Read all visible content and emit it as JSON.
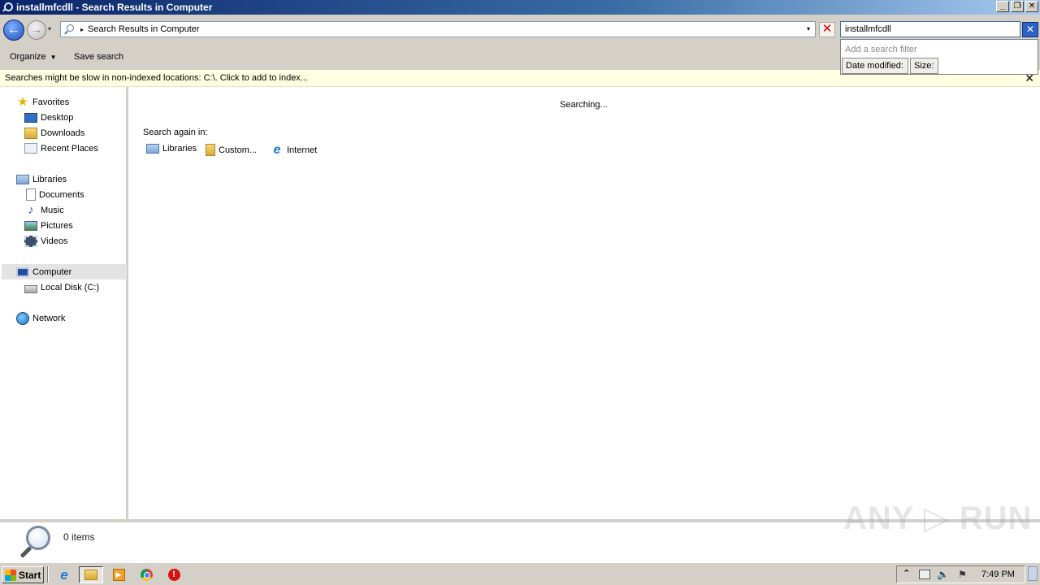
{
  "window": {
    "title": "installmfcdll - Search Results in Computer",
    "controls": {
      "minimize": "_",
      "maximize": "❐",
      "close": "✕"
    }
  },
  "nav": {
    "back": "←",
    "forward": "→",
    "recent": "▾"
  },
  "address": {
    "separator": "▸",
    "location": "Search Results in Computer",
    "dropdown": "▾",
    "stop": "✕"
  },
  "search": {
    "query": "installmfcdll",
    "clear": "✕"
  },
  "filter": {
    "hint": "Add a search filter",
    "tags": [
      "Date modified:",
      "Size:"
    ]
  },
  "toolbar": {
    "organize": "Organize",
    "organize_arrow": "▼",
    "save_search": "Save search"
  },
  "infobar": {
    "text": "Searches might be slow in non-indexed locations: C:\\. Click to add to index...",
    "close": "✕"
  },
  "sidebar": {
    "favorites": {
      "label": "Favorites",
      "items": [
        "Desktop",
        "Downloads",
        "Recent Places"
      ]
    },
    "libraries": {
      "label": "Libraries",
      "items": [
        "Documents",
        "Music",
        "Pictures",
        "Videos"
      ]
    },
    "computer": {
      "label": "Computer",
      "items": [
        "Local Disk (C:)"
      ]
    },
    "network": {
      "label": "Network"
    }
  },
  "content": {
    "status": "Searching...",
    "search_again_label": "Search again in:",
    "search_again_items": [
      "Libraries",
      "Custom...",
      "Internet"
    ]
  },
  "details": {
    "count": "0 items",
    "watermark": "ANY ▷ RUN"
  },
  "taskbar": {
    "start": "Start",
    "clock": "7:49 PM",
    "tray_arrow": "⌃"
  },
  "colors": {
    "titlebar": "#0a246a",
    "infobar": "#ffffe1",
    "selection": "#e4e4e4"
  }
}
